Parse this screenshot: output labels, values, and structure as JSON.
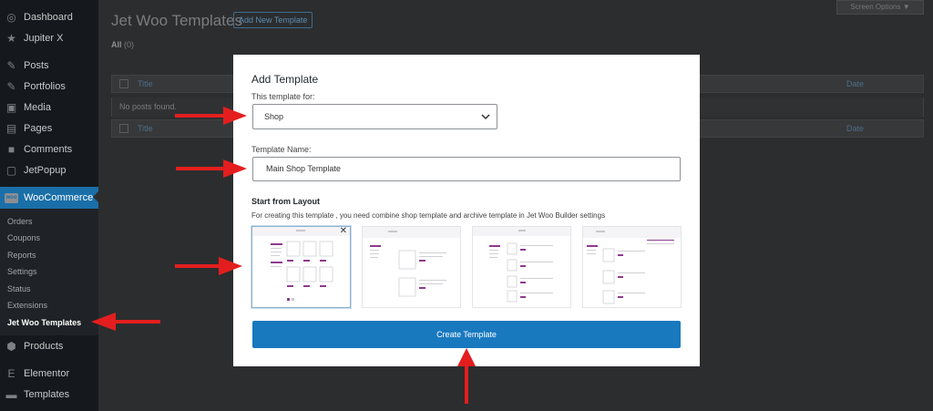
{
  "sidebar": {
    "items": [
      {
        "label": "Dashboard",
        "icon": "dashboard-icon",
        "glyph": "◎"
      },
      {
        "label": "Jupiter X",
        "icon": "star-icon",
        "glyph": "★"
      },
      {
        "label": "Posts",
        "icon": "pin-icon",
        "glyph": "✎"
      },
      {
        "label": "Portfolios",
        "icon": "pin-icon",
        "glyph": "✎"
      },
      {
        "label": "Media",
        "icon": "media-icon",
        "glyph": "▣"
      },
      {
        "label": "Pages",
        "icon": "pages-icon",
        "glyph": "▤"
      },
      {
        "label": "Comments",
        "icon": "comment-icon",
        "glyph": "■"
      },
      {
        "label": "JetPopup",
        "icon": "popup-icon",
        "glyph": "▢"
      },
      {
        "label": "WooCommerce",
        "icon": "woocommerce-icon",
        "glyph": "W"
      }
    ],
    "submenu": [
      "Orders",
      "Coupons",
      "Reports",
      "Settings",
      "Status",
      "Extensions",
      "Jet Woo Templates"
    ],
    "bottom_items": [
      {
        "label": "Products",
        "icon": "box-icon",
        "glyph": "⬢"
      },
      {
        "label": "Elementor",
        "icon": "elementor-icon",
        "glyph": "E"
      },
      {
        "label": "Templates",
        "icon": "folder-icon",
        "glyph": "▬"
      }
    ],
    "woo_logo_text": "woo"
  },
  "page": {
    "title": "Jet Woo Templates",
    "add_new_label": "Add New Template",
    "screen_options": "Screen Options ▼",
    "filter_all": "All",
    "filter_count": "(0)",
    "col_title": "Title",
    "col_date": "Date",
    "no_posts": "No posts found."
  },
  "modal": {
    "title": "Add Template",
    "template_for_label": "This template for:",
    "template_for_value": "Shop",
    "template_name_label": "Template Name:",
    "template_name_value": "Main Shop Template",
    "start_from_label": "Start from Layout",
    "start_from_desc": "For creating this template , you need combine shop template and archive template in Jet Woo Builder settings",
    "close_glyph": "✕",
    "create_button": "Create Template"
  },
  "colors": {
    "sidebar_bg": "#15181c",
    "active_item": "#1a6fa8",
    "primary_button": "#1879bf",
    "arrow": "#e41e1e",
    "accent_purple": "#8e3a8e"
  }
}
